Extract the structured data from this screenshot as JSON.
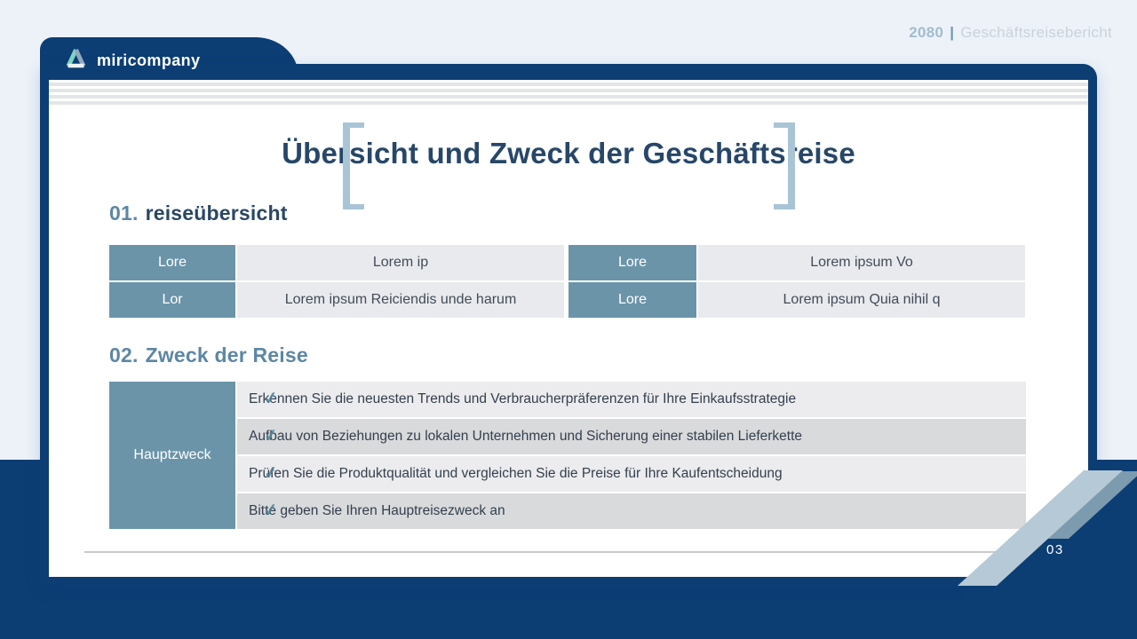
{
  "header": {
    "code": "2080",
    "separator": "|",
    "title": "Geschäftsreisebericht"
  },
  "brand": {
    "name": "miricompany"
  },
  "slide": {
    "title": "Übersicht und Zweck der Geschäftsreise",
    "page_number": "03"
  },
  "overview": {
    "number": "01.",
    "heading": "reiseübersicht",
    "rows": [
      {
        "cells": [
          {
            "label": "Lore",
            "value": "Lorem ip"
          },
          {
            "label": "Lore",
            "value": "Lorem ipsum Vo"
          }
        ]
      },
      {
        "cells": [
          {
            "label": "Lor",
            "value": "Lorem ipsum Reiciendis unde harum"
          },
          {
            "label": "Lore",
            "value": "Lorem ipsum Quia nihil q"
          }
        ]
      }
    ]
  },
  "purpose": {
    "number": "02.",
    "heading": "Zweck der Reise",
    "row_header": "Hauptzweck",
    "items": [
      "Erkennen Sie die neuesten Trends und Verbraucherpräferenzen für Ihre Einkaufsstrategie",
      "Aufbau von Beziehungen zu lokalen Unternehmen und Sicherung einer stabilen Lieferkette",
      "Prüfen Sie die Produktqualität und vergleichen Sie die Preise für Ihre Kaufentscheidung",
      "Bitte geben Sie Ihren Hauptreisezweck an"
    ]
  },
  "icons": {
    "check": "✓"
  },
  "colors": {
    "navy": "#0c3e74",
    "teal_cell": "#6b94a9",
    "steel_heading": "#5d87a4",
    "bracket": "#a9c4d5",
    "stripe_light": "#b6c9d6",
    "stripe_dark": "#7d9bae",
    "row_light": "#ececee",
    "row_dark": "#d9dadc"
  }
}
